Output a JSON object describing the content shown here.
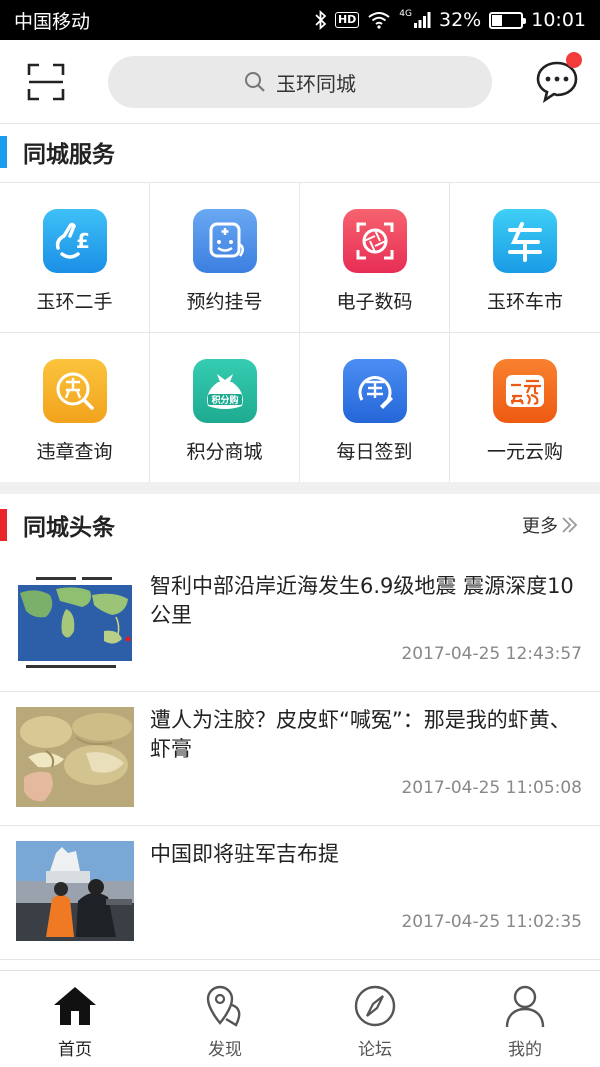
{
  "status_bar": {
    "carrier": "中国移动",
    "network": "4G",
    "battery": "32%",
    "time": "10:01",
    "hd": "HD"
  },
  "header": {
    "search_text": "玉环同城"
  },
  "services": {
    "title": "同城服务",
    "accent": "#1a9cf0",
    "items": [
      {
        "label": "玉环二手",
        "icon": "second-hand-icon",
        "color": "#2aa8f0"
      },
      {
        "label": "预约挂号",
        "icon": "doctor-icon",
        "color": "#4a90e2"
      },
      {
        "label": "电子数码",
        "icon": "camera-aperture-icon",
        "color": "#f0445a"
      },
      {
        "label": "玉环车市",
        "icon": "car-char-icon",
        "color": "#1fb4ea"
      },
      {
        "label": "违章查询",
        "icon": "violation-icon",
        "color": "#f4b324"
      },
      {
        "label": "积分商城",
        "icon": "points-bag-icon",
        "color": "#2bbfa4"
      },
      {
        "label": "每日签到",
        "icon": "sign-in-icon",
        "color": "#3a7be8"
      },
      {
        "label": "一元云购",
        "icon": "one-yuan-icon",
        "color": "#f36a1f"
      }
    ]
  },
  "headlines": {
    "title": "同城头条",
    "more": "更多",
    "accent": "#e8262c",
    "items": [
      {
        "title": "智利中部沿岸近海发生6.9级地震 震源深度10公里",
        "time": "2017-04-25 12:43:57",
        "thumb": "world-map-image"
      },
      {
        "title": "遭人为注胶？皮皮虾“喊冤”：那是我的虾黄、虾膏",
        "time": "2017-04-25 11:05:08",
        "thumb": "shrimp-image"
      },
      {
        "title": "中国即将驻军吉布提",
        "time": "2017-04-25 11:02:35",
        "thumb": "navy-soldiers-image"
      }
    ]
  },
  "tabs": [
    {
      "label": "首页",
      "icon": "home-icon",
      "active": true
    },
    {
      "label": "发现",
      "icon": "location-pin-icon",
      "active": false
    },
    {
      "label": "论坛",
      "icon": "compass-icon",
      "active": false
    },
    {
      "label": "我的",
      "icon": "user-icon",
      "active": false
    }
  ]
}
